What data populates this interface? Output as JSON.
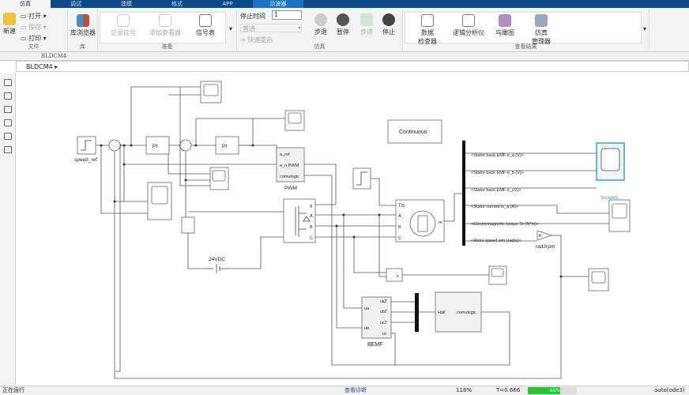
{
  "tabs": [
    "仿真",
    "调试",
    "建模",
    "格式",
    "APP",
    "示波器"
  ],
  "ribbon": {
    "file": {
      "new": "新建",
      "open": "打开",
      "save": "保存",
      "print": "打印",
      "label": "文件"
    },
    "library": {
      "browser": "库浏览器",
      "label": "库"
    },
    "prepare": {
      "log": "记录信号",
      "viewer": "添加查看器",
      "table": "信号表",
      "label": "准备"
    },
    "sim": {
      "stop_time_label": "停止时间",
      "stop_time": "1",
      "mode": "普通",
      "fast_restart": "快速重启",
      "step_back": "步退",
      "pause": "暂停",
      "step_fwd": "步进",
      "stop": "停止",
      "label": "仿真"
    },
    "results": {
      "inspector": "数据\n检查器",
      "logic": "逻辑分析仪",
      "birdseye": "鸟瞰图",
      "manager": "仿真\n管理器",
      "label": "查看结果"
    }
  },
  "address": "BLDCM4",
  "breadcrumb": "BLDCM4",
  "diagram": {
    "speed_ref": "speed_ref",
    "pi1": "PI",
    "pi2": "PI",
    "pwm": "PWM",
    "pwm_ports": [
      "a_ref",
      "e_n PWM",
      "comulogic"
    ],
    "inv_ports": [
      "g",
      "A",
      "B",
      "C"
    ],
    "dc": "24VDC",
    "continuous": "Continuous",
    "motor_ports": [
      "Tm",
      "A",
      "B",
      "C",
      "m"
    ],
    "bus": [
      "<Stator back EMF e_a (V)>",
      "<Stator back EMF e_b (V)>",
      "<Stator back EMF e_cV)>",
      "<Stator current is_a (A)>",
      "<Electromagnetic torque Te (N*m)>",
      "<Rotor speed wm (rad/s)>"
    ],
    "scope6": "Scope6",
    "rad2rpm": "rad2rpm",
    "gain": "K-",
    "bemf": "BEMF",
    "bemf_in": [
      "ua",
      "ub"
    ],
    "bemf_out": [
      "ua2'",
      "ub2'",
      "uc2'",
      "uc"
    ],
    "hall_in": "Hall",
    "hall_out": "comulogic",
    "vm": "v"
  },
  "status": {
    "state": "正在运行",
    "diag": "查看诊断",
    "zoom": "118%",
    "time": "T=0.666",
    "progress": 66,
    "progress_label": "66%",
    "solver": "auto(ode3)"
  },
  "colors": {
    "tabbar": "#0b4a86",
    "highlight": "#3aa0c8",
    "progress": "#2ec42e"
  }
}
